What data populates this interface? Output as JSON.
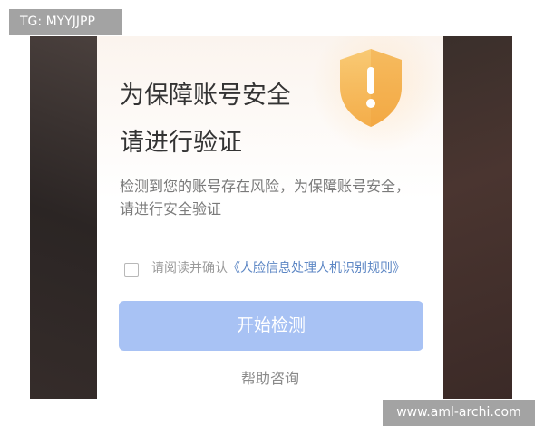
{
  "watermark": {
    "top_left": "TG: MYYJJPP",
    "bottom_right": "www.aml-archi.com"
  },
  "dialog": {
    "title_line1": "为保障账号安全",
    "title_line2": "请进行验证",
    "description": "检测到您的账号存在风险，为保障账号安全，请进行安全验证",
    "agreement_prefix": "请阅读并确认",
    "agreement_link": "《人脸信息处理人机识别规则》",
    "agreement_checked": false,
    "start_button": "开始检测",
    "help_link": "帮助咨询",
    "shield_icon": "shield-warning-icon",
    "colors": {
      "button": "#a8c2f4",
      "link": "#5c86c4",
      "shield": "#f5b44a"
    }
  }
}
